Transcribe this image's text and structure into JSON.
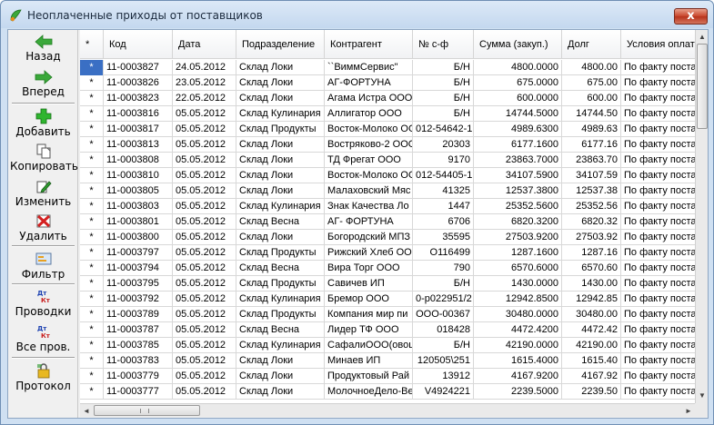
{
  "window": {
    "title": "Неоплаченные приходы от поставщиков",
    "close_label": "x",
    "icon": "app-logo-icon"
  },
  "toolbar": {
    "back": {
      "label": "Назад",
      "icon": "arrow-left-icon"
    },
    "forward": {
      "label": "Вперед",
      "icon": "arrow-right-icon"
    },
    "add": {
      "label": "Добавить",
      "icon": "plus-icon"
    },
    "copy": {
      "label": "Копировать",
      "icon": "copy-icon"
    },
    "edit": {
      "label": "Изменить",
      "icon": "edit-icon"
    },
    "delete": {
      "label": "Удалить",
      "icon": "delete-icon"
    },
    "filter": {
      "label": "Фильтр",
      "icon": "filter-icon"
    },
    "postings": {
      "label": "Проводки",
      "icon": "postings-icon"
    },
    "all_postings": {
      "label": "Все пров.",
      "icon": "all-postings-icon"
    },
    "log": {
      "label": "Протокол",
      "icon": "log-icon"
    }
  },
  "grid": {
    "columns": [
      "*",
      "Код",
      "Дата",
      "Подразделение",
      "Контрагент",
      "№ с-ф",
      "Сумма (закуп.)",
      "Долг",
      "Условия оплаты"
    ],
    "rows": [
      [
        "*",
        "11-0003827",
        "24.05.2012",
        "Склад Локи",
        "``ВиммСервис\"",
        "Б/Н",
        "4800.0000",
        "4800.00",
        "По факту постав"
      ],
      [
        "*",
        "11-0003826",
        "23.05.2012",
        "Склад Локи",
        "АГ-ФОРТУНА",
        "Б/Н",
        "675.0000",
        "675.00",
        "По факту постав"
      ],
      [
        "*",
        "11-0003823",
        "22.05.2012",
        "Склад Локи",
        "Агама Истра ООО",
        "Б/Н",
        "600.0000",
        "600.00",
        "По факту постав"
      ],
      [
        "*",
        "11-0003816",
        "05.05.2012",
        "Склад Кулинария",
        "Аллигатор ООО",
        "Б/Н",
        "14744.5000",
        "14744.50",
        "По факту постав"
      ],
      [
        "*",
        "11-0003817",
        "05.05.2012",
        "Склад Продукты",
        "Восток-Молоко ОО",
        "012-54642-1",
        "4989.6300",
        "4989.63",
        "По факту постав"
      ],
      [
        "*",
        "11-0003813",
        "05.05.2012",
        "Склад Локи",
        "Востряково-2 ООО",
        "20303",
        "6177.1600",
        "6177.16",
        "По факту постав"
      ],
      [
        "*",
        "11-0003808",
        "05.05.2012",
        "Склад Локи",
        "ТД Фрегат ООО",
        "9170",
        "23863.7000",
        "23863.70",
        "По факту постав"
      ],
      [
        "*",
        "11-0003810",
        "05.05.2012",
        "Склад Локи",
        "Восток-Молоко ОО",
        "012-54405-1",
        "34107.5900",
        "34107.59",
        "По факту постав"
      ],
      [
        "*",
        "11-0003805",
        "05.05.2012",
        "Склад Локи",
        "Малаховский Мяс",
        "41325",
        "12537.3800",
        "12537.38",
        "По факту постав"
      ],
      [
        "*",
        "11-0003803",
        "05.05.2012",
        "Склад Кулинария",
        "Знак Качества Ло",
        "1447",
        "25352.5600",
        "25352.56",
        "По факту постав"
      ],
      [
        "*",
        "11-0003801",
        "05.05.2012",
        "Склад Весна",
        "АГ- ФОРТУНА",
        "6706",
        "6820.3200",
        "6820.32",
        "По факту постав"
      ],
      [
        "*",
        "11-0003800",
        "05.05.2012",
        "Склад Локи",
        "Богородский МПЗ",
        "35595",
        "27503.9200",
        "27503.92",
        "По факту постав"
      ],
      [
        "*",
        "11-0003797",
        "05.05.2012",
        "Склад Продукты",
        "Рижский Хлеб ООО",
        "О116499",
        "1287.1600",
        "1287.16",
        "По факту постав"
      ],
      [
        "*",
        "11-0003794",
        "05.05.2012",
        "Склад Весна",
        "Вира Торг ООО",
        "790",
        "6570.6000",
        "6570.60",
        "По факту постав"
      ],
      [
        "*",
        "11-0003795",
        "05.05.2012",
        "Склад Продукты",
        "Савичев ИП",
        "Б/Н",
        "1430.0000",
        "1430.00",
        "По факту постав"
      ],
      [
        "*",
        "11-0003792",
        "05.05.2012",
        "Склад Кулинария",
        "Бремор ООО",
        "0-р022951/2",
        "12942.8500",
        "12942.85",
        "По факту постав"
      ],
      [
        "*",
        "11-0003789",
        "05.05.2012",
        "Склад Продукты",
        "Компания мир пи",
        "ООО-00367",
        "30480.0000",
        "30480.00",
        "По факту постав"
      ],
      [
        "*",
        "11-0003787",
        "05.05.2012",
        "Склад Весна",
        "Лидер ТФ ООО",
        "018428",
        "4472.4200",
        "4472.42",
        "По факту постав"
      ],
      [
        "*",
        "11-0003785",
        "05.05.2012",
        "Склад Кулинария",
        "СафалиООО(овош",
        "Б/Н",
        "42190.0000",
        "42190.00",
        "По факту постав"
      ],
      [
        "*",
        "11-0003783",
        "05.05.2012",
        "Склад Локи",
        "Минаев ИП",
        "120505\\251",
        "1615.4000",
        "1615.40",
        "По факту постав"
      ],
      [
        "*",
        "11-0003779",
        "05.05.2012",
        "Склад Локи",
        "Продуктовый Рай",
        "13912",
        "4167.9200",
        "4167.92",
        "По факту постав"
      ],
      [
        "*",
        "11-0003777",
        "05.05.2012",
        "Склад Локи",
        "МолочноеДело-Ве",
        "V4924221",
        "2239.5000",
        "2239.50",
        "По факту постав"
      ]
    ],
    "selected_row": 0,
    "selected_col": 0
  },
  "scrollbars": {
    "up_arrow": "▲",
    "down_arrow": "▼",
    "left_arrow": "◄",
    "right_arrow": "►"
  },
  "colors": {
    "selection": "#3a6fc4",
    "green_arrow": "#3aa83a",
    "red_delete": "#d42020"
  }
}
